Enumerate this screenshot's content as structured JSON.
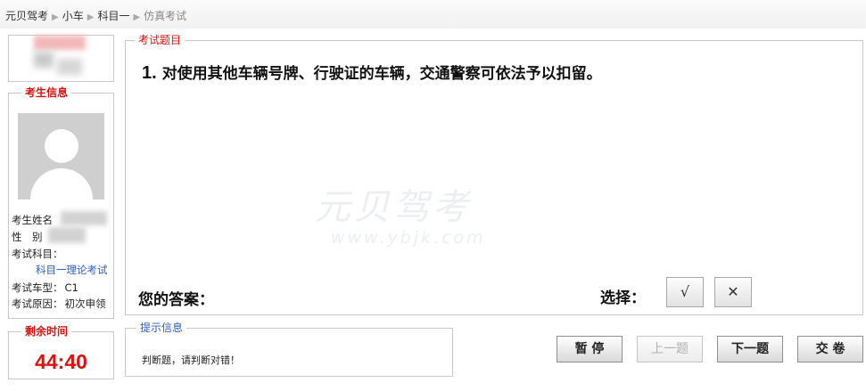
{
  "breadcrumb": {
    "items": [
      "元贝驾考",
      "小车",
      "科目一",
      "仿真考试"
    ]
  },
  "exam_info": {
    "legend": "考生信息",
    "name_label": "考生姓名",
    "gender_label": "性　别",
    "subject_label": "考试科目：",
    "subject_value": "科目一理论考试",
    "vehicle_label": "考试车型：",
    "vehicle_value": "C1",
    "reason_label": "考试原因：",
    "reason_value": "初次申领"
  },
  "timer": {
    "legend": "剩余时间",
    "value": "44:40"
  },
  "question": {
    "legend": "考试题目",
    "number": "1.",
    "text": "对使用其他车辆号牌、行驶证的车辆，交通警察可依法予以扣留。",
    "watermark_cn": "元贝驾考",
    "watermark_url": "www.ybjk.com",
    "answer_label": "您的答案：",
    "choose_label": "选择：",
    "option_true": "√",
    "option_false": "✕"
  },
  "hint": {
    "legend": "提示信息",
    "text": "判断题，请判断对错！"
  },
  "controls": {
    "pause": "暂 停",
    "prev": "上一题",
    "next": "下一题",
    "submit": "交 卷"
  }
}
